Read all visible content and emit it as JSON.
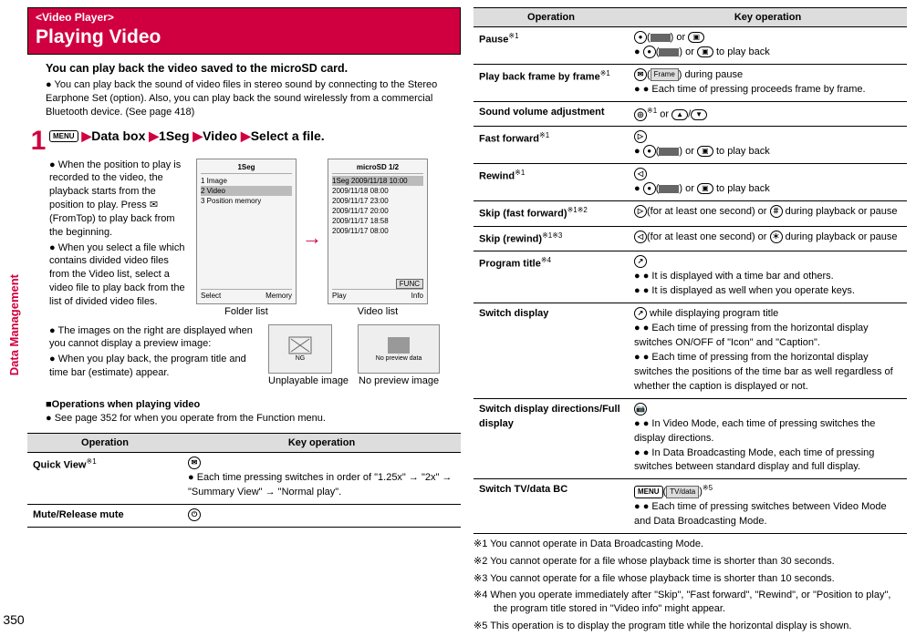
{
  "sidebar": {
    "label": "Data Management",
    "page": "350"
  },
  "header": {
    "kicker": "<Video Player>",
    "title": "Playing Video"
  },
  "intro": "You can play back the video saved to the microSD card.",
  "intro_bullet": "You can play back the sound of video files in stereo sound by connecting to the Stereo Earphone Set (option). Also, you can play back the sound wirelessly from a commercial Bluetooth device. (See page 418)",
  "step": {
    "num": "1",
    "menu_key": "MENU",
    "t1": "Data box",
    "t2": "1Seg",
    "t3": "Video",
    "t4": "Select a file."
  },
  "left_bullets": [
    "When the position to play is recorded to the video, the playback starts from the position to play. Press ✉(FromTop) to play back from the beginning.",
    "When you select a file which contains divided video files from the Video list, select a video file to play back from the list of divided video files."
  ],
  "folder_img": {
    "title": "1Seg",
    "items": [
      "1 Image",
      "2 Video",
      "3 Position memory"
    ],
    "footer_l": "Select",
    "footer_r": "Memory",
    "caption": "Folder list"
  },
  "video_img": {
    "title": "microSD      1/2",
    "top": "1Seg  2009/11/18 10:00",
    "items": [
      "2009/11/18 08:00",
      "2009/11/17 23:00",
      "2009/11/17 20:00",
      "2009/11/17 18:58",
      "2009/11/17 08:00"
    ],
    "footer_l": "Play",
    "footer_r": "Info",
    "func": "FUNC",
    "caption": "Video list"
  },
  "img_notes": [
    "The images on the right are displayed when you cannot display a preview image:",
    "When you play back, the program title and time bar (estimate) appear."
  ],
  "unplayable_caption": "Unplayable image",
  "nopreview_caption": "No preview image",
  "nopreview_text": "No preview data",
  "ng_text": "NG",
  "ops_heading": "■Operations when playing video",
  "ops_note": "See page 352 for when you operate from the Function menu.",
  "table_head": {
    "c1": "Operation",
    "c2": "Key operation"
  },
  "left_table": [
    {
      "op": "Quick View",
      "sup": "※1",
      "key_lines": [
        "✉",
        "Each time pressing switches in order of \"1.25x\" → \"2x\" → \"Summary View\" → \"Normal play\"."
      ],
      "bullet_from": 1
    },
    {
      "op": "Mute/Release mute",
      "sup": "",
      "key_lines": [
        "⏻"
      ],
      "bullet_from": 99
    }
  ],
  "right_table": [
    {
      "op": "Pause",
      "sup": "※1",
      "lines": [
        "●(▮▮) or ▣",
        "●(▶) or ▣ to play back"
      ]
    },
    {
      "op": "Play back frame by frame",
      "sup": "※1",
      "lines": [
        "✉(Frame) during pause",
        "● Each time of pressing proceeds frame by frame."
      ]
    },
    {
      "op": "Sound volume adjustment",
      "sup": "",
      "lines": [
        "◎※1 or ▲/▼"
      ]
    },
    {
      "op": "Fast forward",
      "sup": "※1",
      "lines": [
        "▷",
        "● ●(▶) or ▣ to play back"
      ]
    },
    {
      "op": "Rewind",
      "sup": "※1",
      "lines": [
        "◁",
        "● ●(▶) or ▣ to play back"
      ]
    },
    {
      "op": "Skip (fast forward)",
      "sup": "※1※2",
      "lines": [
        "▷(for at least one second) or ＃ during playback or pause"
      ]
    },
    {
      "op": "Skip (rewind)",
      "sup": "※1※3",
      "lines": [
        "◁(for at least one second) or ＊ during playback or pause"
      ]
    },
    {
      "op": "Program title",
      "sup": "※4",
      "lines": [
        "↗",
        "● It is displayed with a time bar and others.",
        "● It is displayed as well when you operate keys."
      ]
    },
    {
      "op": "Switch display",
      "sup": "",
      "lines": [
        "↗ while displaying program title",
        "● Each time of pressing from the horizontal display switches ON/OFF of \"Icon\" and \"Caption\".",
        "● Each time of pressing from the horizontal display switches the positions of the time bar as well regardless of whether the caption is displayed or not."
      ]
    },
    {
      "op": "Switch display directions/Full display",
      "sup": "",
      "lines": [
        "📷",
        "● In Video Mode, each time of pressing switches the display directions.",
        "● In Data Broadcasting Mode, each time of pressing switches between standard display and full display."
      ]
    },
    {
      "op": "Switch TV/data BC",
      "sup": "",
      "lines": [
        "MENU(TV/data)※5",
        "● Each time of pressing switches between Video Mode and Data Broadcasting Mode."
      ]
    }
  ],
  "footnotes": [
    "※1 You cannot operate in Data Broadcasting Mode.",
    "※2 You cannot operate for a file whose playback time is shorter than 30 seconds.",
    "※3 You cannot operate for a file whose playback time is shorter than 10 seconds.",
    "※4 When you operate immediately after \"Skip\", \"Fast forward\", \"Rewind\", or \"Position to play\", the program title stored in \"Video info\" might appear.",
    "※5 This operation is to display the program title while the horizontal display is shown."
  ]
}
